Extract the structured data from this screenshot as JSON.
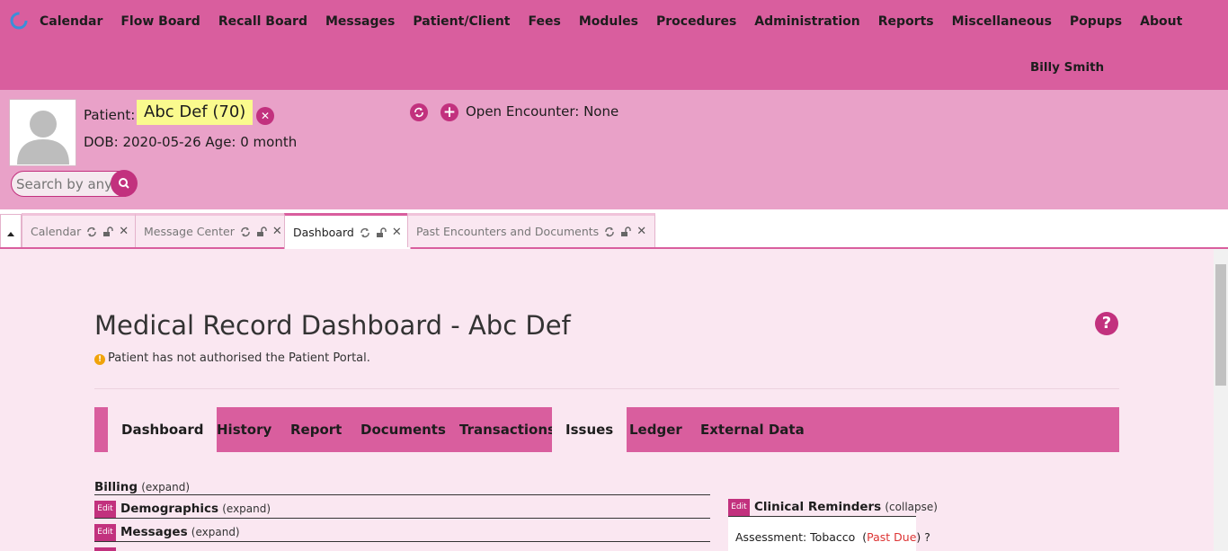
{
  "nav": {
    "items": [
      "Calendar",
      "Flow Board",
      "Recall Board",
      "Messages",
      "Patient/Client",
      "Fees",
      "Modules",
      "Procedures",
      "Administration",
      "Reports",
      "Miscellaneous",
      "Popups",
      "About"
    ],
    "user": "Billy Smith"
  },
  "patient": {
    "label": "Patient:",
    "name": "Abc Def (70)",
    "dob_line": "DOB: 2020-05-26 Age: 0 month",
    "encounter": "Open Encounter: None",
    "search_placeholder": "Search by any"
  },
  "tabs": [
    {
      "label": "Calendar"
    },
    {
      "label": "Message Center"
    },
    {
      "label": "Dashboard"
    },
    {
      "label": "Past Encounters and Documents"
    }
  ],
  "dashboard": {
    "title": "Medical Record Dashboard - Abc Def",
    "notice": "Patient has not authorised the Patient Portal.",
    "subnav": [
      "Dashboard",
      "History",
      "Report",
      "Documents",
      "Transactions",
      "Issues",
      "Ledger",
      "External Data"
    ],
    "sections": [
      {
        "title": "Billing",
        "toggle": "(expand)"
      },
      {
        "title": "Demographics",
        "toggle": "(expand)",
        "edit": "Edit"
      },
      {
        "title": "Messages",
        "toggle": "(expand)",
        "edit": "Edit"
      }
    ],
    "reminders": {
      "edit": "Edit",
      "title": "Clinical Reminders",
      "toggle": "(collapse)",
      "item": "Assessment: Tobacco",
      "status": "Past Due",
      "suffix": "?"
    }
  },
  "colors": {
    "nav_bg": "#d95e9e",
    "header_bg": "#e9a1c8",
    "accent": "#c2317e",
    "content_bg": "#fae7f1",
    "name_highlight": "#fafa8e"
  }
}
